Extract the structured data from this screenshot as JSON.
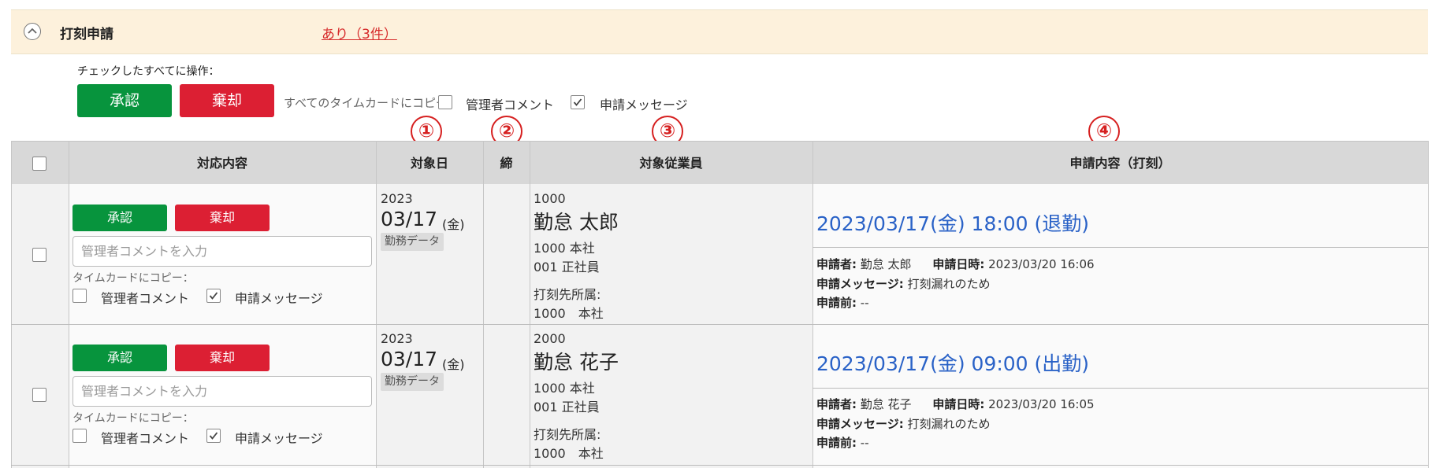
{
  "header": {
    "title": "打刻申請",
    "link": "あり（3件）"
  },
  "bulk": {
    "label": "チェックしたすべてに操作：",
    "approve": "承認",
    "reject": "棄却",
    "copy_label": "すべてのタイムカードにコピー：",
    "admin_comment": "管理者コメント",
    "admin_comment_checked": false,
    "request_message": "申請メッセージ",
    "request_message_checked": true
  },
  "markers": [
    "①",
    "②",
    "③",
    "④"
  ],
  "columns": {
    "action": "対応内容",
    "date": "対象日",
    "close": "締",
    "employee": "対象従業員",
    "request": "申請内容（打刻）"
  },
  "rows": [
    {
      "approve": "承認",
      "reject": "棄却",
      "comment_placeholder": "管理者コメントを入力",
      "copy_label": "タイムカードにコピー：",
      "admin_comment": "管理者コメント",
      "request_message": "申請メッセージ",
      "year": "2023",
      "date": "03/17",
      "dow": "(金)",
      "tag": "勤務データ",
      "emp_code": "1000",
      "emp_name": "勤怠 太郎",
      "dept": "1000 本社",
      "position": "001 正社員",
      "punch_dept_label": "打刻先所属:",
      "punch_dept": "1000　本社",
      "request_title": "2023/03/17(金) 18:00 (退勤)",
      "applicant_label": "申請者:",
      "applicant": "勤怠 太郎",
      "applied_at_label": "申請日時:",
      "applied_at": "2023/03/20 16:06",
      "message_label": "申請メッセージ:",
      "message": "打刻漏れのため",
      "before_label": "申請前:",
      "before": "--"
    },
    {
      "approve": "承認",
      "reject": "棄却",
      "comment_placeholder": "管理者コメントを入力",
      "copy_label": "タイムカードにコピー：",
      "admin_comment": "管理者コメント",
      "request_message": "申請メッセージ",
      "year": "2023",
      "date": "03/17",
      "dow": "(金)",
      "tag": "勤務データ",
      "emp_code": "2000",
      "emp_name": "勤怠 花子",
      "dept": "1000 本社",
      "position": "001 正社員",
      "punch_dept_label": "打刻先所属:",
      "punch_dept": "1000　本社",
      "request_title": "2023/03/17(金) 09:00 (出勤)",
      "applicant_label": "申請者:",
      "applicant": "勤怠 花子",
      "applied_at_label": "申請日時:",
      "applied_at": "2023/03/20 16:05",
      "message_label": "申請メッセージ:",
      "message": "打刻漏れのため",
      "before_label": "申請前:",
      "before": "--"
    }
  ]
}
